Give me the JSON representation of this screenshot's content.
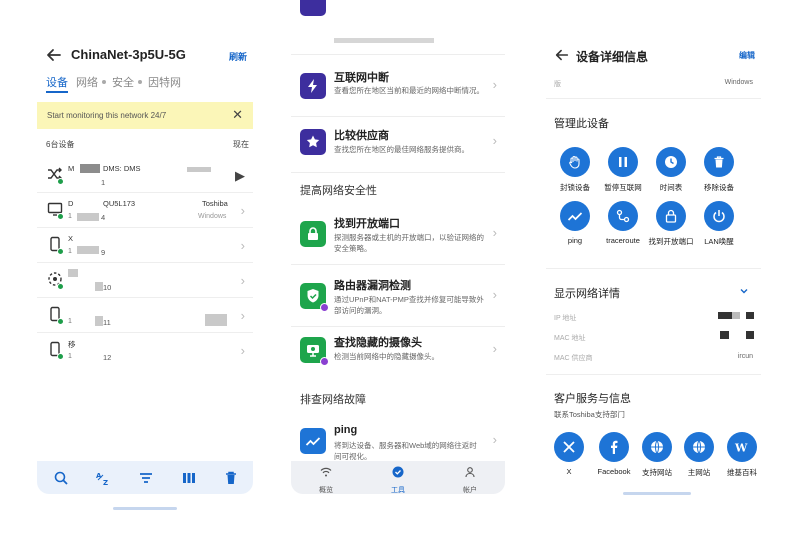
{
  "colors": {
    "accent": "#1666c9",
    "action_blue": "#1e74d6",
    "online_green": "#1e9e4a",
    "banner_yellow": "#fbf6b8",
    "tool_purple": "#3d2e9e",
    "tool_green": "#1ea54c"
  },
  "panel1": {
    "title": "ChinaNet-3p5U-5G",
    "refresh_label": "刷新",
    "tabs": [
      "设备",
      "网络",
      "安全",
      "因特网"
    ],
    "banner_text": "Start monitoring this network 24/7",
    "device_count": "6台设备",
    "now_label": "现在",
    "devices": [
      {
        "icon": "shuffle-icon",
        "name": "M",
        "name2": "DMS: DMS",
        "sub": "1",
        "num": "1",
        "right_name": "",
        "right_sub": ""
      },
      {
        "icon": "monitor-icon",
        "name": "D",
        "name2": "QU5L173",
        "sub": "1",
        "num": "4",
        "right_name": "Toshiba",
        "right_sub": "Windows"
      },
      {
        "icon": "phone-icon",
        "name": "X",
        "name2": "",
        "sub": "1",
        "num": "9",
        "right_name": "",
        "right_sub": ""
      },
      {
        "icon": "unknown-device-icon",
        "name": "",
        "name2": "",
        "sub": "",
        "num": "10",
        "right_name": "",
        "right_sub": ""
      },
      {
        "icon": "phone-icon",
        "name": "",
        "name2": "",
        "sub": "1",
        "num": "11",
        "right_name": "",
        "right_sub": ""
      },
      {
        "icon": "phone-icon",
        "name": "移",
        "name2": "",
        "sub": "1",
        "num": "12",
        "right_name": "",
        "right_sub": ""
      }
    ],
    "bottom_actions": [
      "search-icon",
      "sort-az-icon",
      "filter-icon",
      "columns-icon",
      "delete-icon"
    ]
  },
  "panel2": {
    "tools_top": [
      {
        "icon": "bolt-icon",
        "title": "互联网中断",
        "desc": "查看您所在地区当前和最近的网络中断情况。",
        "color": "#3d2e9e"
      },
      {
        "icon": "star-badge-icon",
        "title": "比较供应商",
        "desc": "查找您所在地区的最佳网络服务提供商。",
        "color": "#3d2e9e"
      }
    ],
    "section_security": "提高网络安全性",
    "tools_security": [
      {
        "icon": "lock-icon",
        "title": "找到开放端口",
        "desc": "探测服务器或主机的开放端口，以验证网络的安全策略。",
        "color": "#1ea54c"
      },
      {
        "icon": "shield-icon",
        "title": "路由器漏洞检测",
        "desc": "通过UPnP和NAT-PMP查找并修复可能导致外部访问的漏洞。",
        "color": "#1ea54c"
      },
      {
        "icon": "camera-icon",
        "title": "查找隐藏的摄像头",
        "desc": "检测当前网络中的隐藏摄像头。",
        "color": "#1ea54c"
      }
    ],
    "section_troubleshoot": "排查网络故障",
    "tools_troubleshoot": [
      {
        "icon": "trend-icon",
        "title": "ping",
        "desc": "将到达设备、服务器和Web域的网络往返时间可视化。",
        "color": "#1e74d6"
      }
    ],
    "nav": [
      {
        "icon": "wifi-icon",
        "label": "概览"
      },
      {
        "icon": "tools-icon",
        "label": "工具"
      },
      {
        "icon": "account-icon",
        "label": "帐户"
      }
    ]
  },
  "panel3": {
    "title": "设备详细信息",
    "edit_label": "编辑",
    "os_label": "版",
    "os_value": "Windows",
    "manage_title": "管理此设备",
    "actions": [
      {
        "icon": "hand-icon",
        "label": "封锁设备"
      },
      {
        "icon": "pause-icon",
        "label": "暂停互联网"
      },
      {
        "icon": "clock-icon",
        "label": "时间表"
      },
      {
        "icon": "trash-icon",
        "label": "移除设备"
      },
      {
        "icon": "ping-icon",
        "label": "ping"
      },
      {
        "icon": "traceroute-icon",
        "label": "traceroute"
      },
      {
        "icon": "lock-icon",
        "label": "找到开放端口"
      },
      {
        "icon": "power-icon",
        "label": "LAN唤醒"
      }
    ],
    "network_title": "显示网络详情",
    "net_rows": [
      {
        "label": "IP 地址",
        "value": ""
      },
      {
        "label": "MAC 地址",
        "value": ""
      },
      {
        "label": "MAC 供应商",
        "value": "ircun"
      }
    ],
    "support_title": "客户服务与信息",
    "support_sub": "联系Toshiba支持部门",
    "support_links": [
      {
        "icon": "x-icon",
        "label": "X"
      },
      {
        "icon": "facebook-icon",
        "label": "Facebook"
      },
      {
        "icon": "globe-icon",
        "label": "支持网站"
      },
      {
        "icon": "globe-icon",
        "label": "主网站"
      },
      {
        "icon": "wikipedia-icon",
        "label": "维基百科"
      }
    ]
  }
}
